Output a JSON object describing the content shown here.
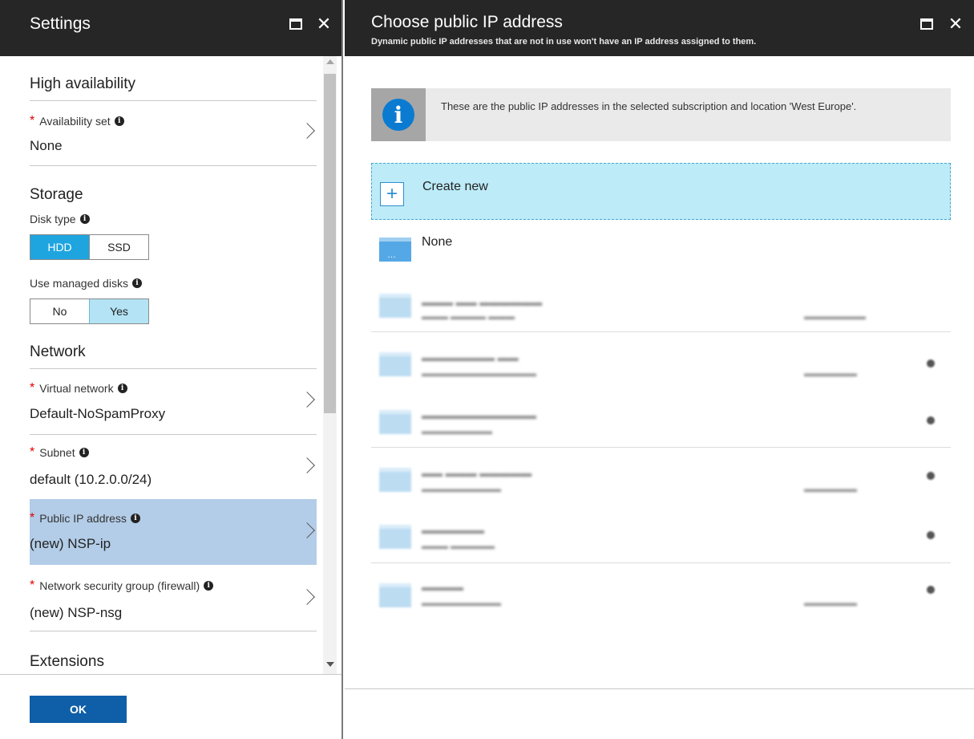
{
  "settings": {
    "title": "Settings",
    "sections": {
      "high_availability": "High availability",
      "storage": "Storage",
      "network": "Network",
      "extensions": "Extensions"
    },
    "availability_set": {
      "label": "Availability set",
      "value": "None"
    },
    "disk_type": {
      "label": "Disk type",
      "options": [
        "HDD",
        "SSD"
      ],
      "selected": "HDD"
    },
    "managed_disks": {
      "label": "Use managed disks",
      "options": [
        "No",
        "Yes"
      ],
      "selected": "Yes"
    },
    "virtual_network": {
      "label": "Virtual network",
      "value": "Default-NoSpamProxy"
    },
    "subnet": {
      "label": "Subnet",
      "value": "default (10.2.0.0/24)"
    },
    "public_ip": {
      "label": "Public IP address",
      "value": "(new) NSP-ip"
    },
    "nsg": {
      "label": "Network security group (firewall)",
      "value": "(new) NSP-nsg"
    },
    "ok_label": "OK"
  },
  "choose_ip": {
    "title": "Choose public IP address",
    "subtitle": "Dynamic public IP addresses that are not in use won't have an IP address assigned to them.",
    "info_text": "These are the public IP addresses in the selected subscription and location 'West Europe'.",
    "create_new_label": "Create new",
    "none_label": "None"
  },
  "colors": {
    "header_bg": "#262626",
    "accent": "#1ea5e0",
    "selected_row": "#b3cde8",
    "create_new_bg": "#bdebf8",
    "ok_button": "#0f5ea8"
  },
  "icons": [
    "maximize-icon",
    "close-icon",
    "info-icon",
    "chevron-right-icon",
    "plus-icon",
    "public-ip-icon"
  ]
}
